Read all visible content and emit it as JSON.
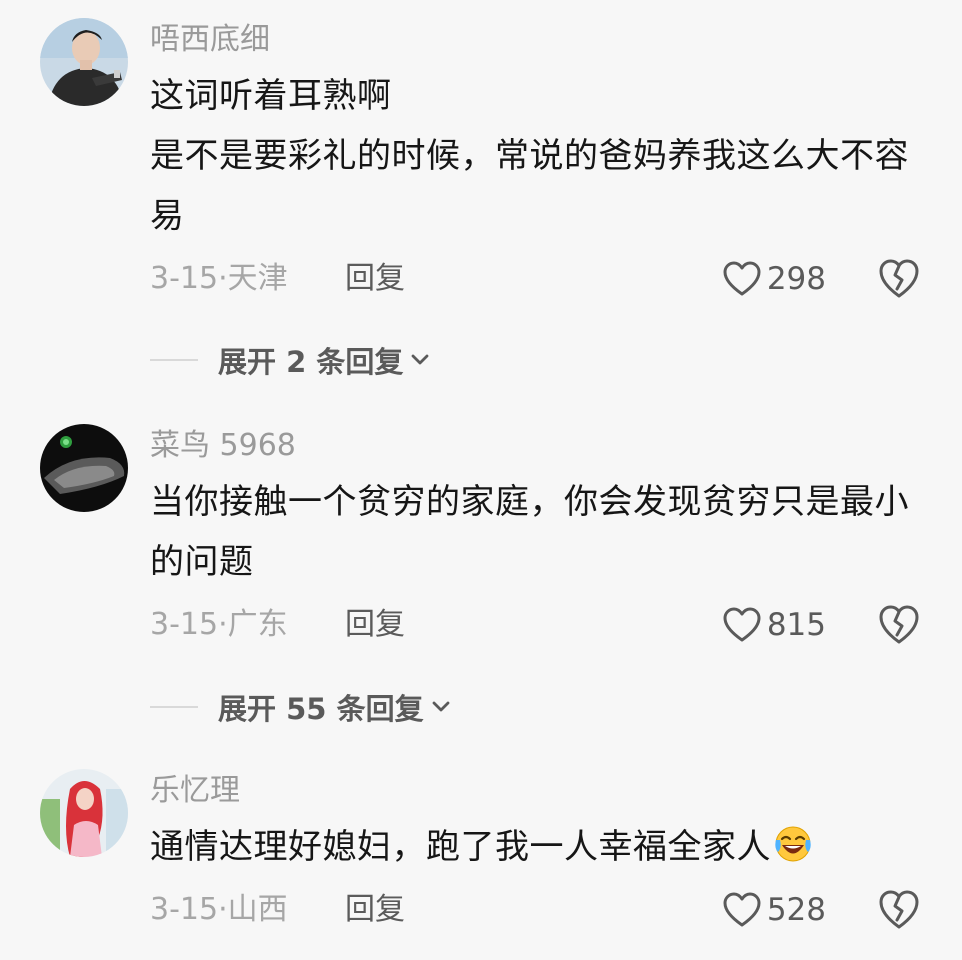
{
  "comments": [
    {
      "username": "唔西底细",
      "text": "这词听着耳熟啊\n是不是要彩礼的时候，常说的爸妈养我这么大不容易",
      "date": "3-15",
      "location": "天津",
      "reply_label": "回复",
      "likes": "298",
      "expand": {
        "prefix": "展开 ",
        "count": "2",
        "suffix": " 条回复"
      }
    },
    {
      "username": "菜鸟 5968",
      "text": "当你接触一个贫穷的家庭，你会发现贫穷只是最小的问题",
      "date": "3-15",
      "location": "广东",
      "reply_label": "回复",
      "likes": "815",
      "expand": {
        "prefix": "展开 ",
        "count": "55",
        "suffix": " 条回复"
      }
    },
    {
      "username": "乐忆理",
      "text": "通情达理好媳妇，跑了我一人幸福全家人",
      "emoji": "laughing-crying-emoji",
      "date": "3-15",
      "location": "山西",
      "reply_label": "回复",
      "likes": "528"
    }
  ],
  "icons": {
    "like": "heart-outline-icon",
    "dislike": "broken-heart-icon",
    "expand": "chevron-down-icon"
  },
  "colors": {
    "background": "#f7f7f7",
    "username": "#9a9a9a",
    "text": "#161616",
    "meta": "#a6a6a6",
    "action": "#5a5a5a"
  }
}
